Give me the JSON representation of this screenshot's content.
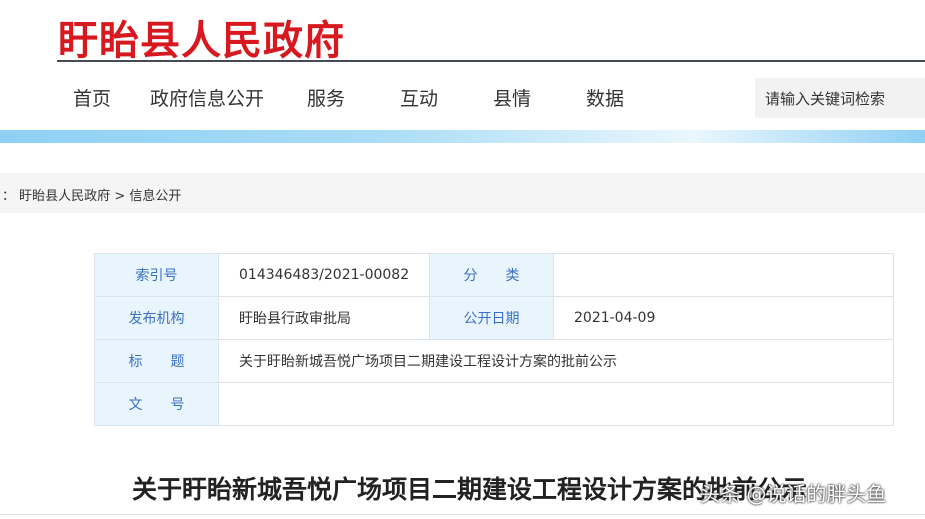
{
  "site": {
    "logo": "盱眙县人民政府"
  },
  "nav": {
    "items": [
      "首页",
      "政府信息公开",
      "服务",
      "互动",
      "县情",
      "数据"
    ],
    "search_placeholder": "请输入关键词检索"
  },
  "breadcrumb": {
    "prefix": "：",
    "home": "盱眙县人民政府",
    "sep": ">",
    "current": "信息公开"
  },
  "info": {
    "index_label": "索引号",
    "index_value": "014346483/2021-00082",
    "category_label": "分　　类",
    "category_value": "",
    "publisher_label": "发布机构",
    "publisher_value": "盱眙县行政审批局",
    "date_label": "公开日期",
    "date_value": "2021-04-09",
    "title_label": "标　　题",
    "title_value": "关于盱眙新城吾悦广场项目二期建设工程设计方案的批前公示",
    "docno_label": "文　　号",
    "docno_value": ""
  },
  "article": {
    "title": "关于盱眙新城吾悦广场项目二期建设工程设计方案的批前公示"
  },
  "watermark": "头条 @说话的胖头鱼"
}
